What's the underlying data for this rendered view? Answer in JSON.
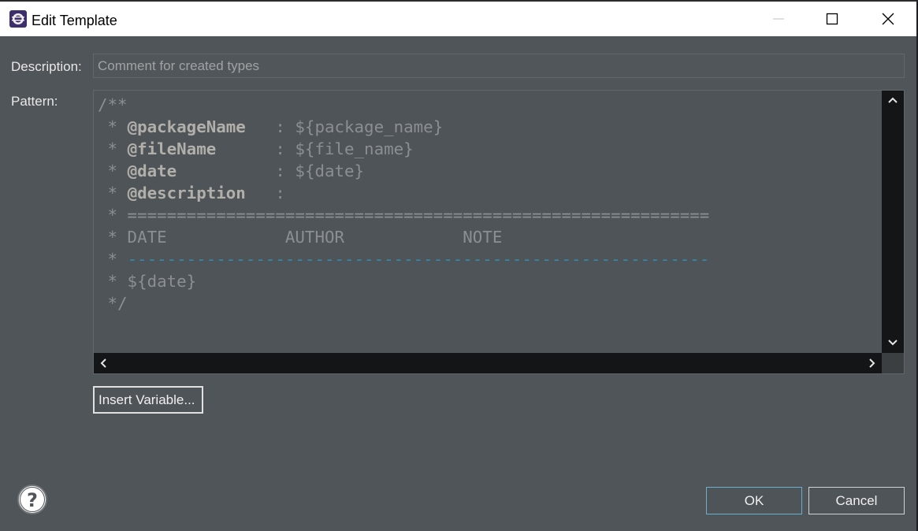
{
  "window": {
    "title": "Edit Template"
  },
  "form": {
    "description_label": "Description:",
    "description_value": "Comment for created types",
    "pattern_label": "Pattern:"
  },
  "pattern": {
    "lines": [
      [
        {
          "t": "/**",
          "c": "plain"
        }
      ],
      [
        {
          "t": " * ",
          "c": "plain"
        },
        {
          "t": "@packageName",
          "c": "tag"
        },
        {
          "t": "   : ${package_name}",
          "c": "plain"
        }
      ],
      [
        {
          "t": " * ",
          "c": "plain"
        },
        {
          "t": "@fileName",
          "c": "tag"
        },
        {
          "t": "      : ${file_name}",
          "c": "plain"
        }
      ],
      [
        {
          "t": " * ",
          "c": "plain"
        },
        {
          "t": "@date",
          "c": "tag"
        },
        {
          "t": "          : ${date}",
          "c": "plain"
        }
      ],
      [
        {
          "t": " * ",
          "c": "plain"
        },
        {
          "t": "@description",
          "c": "tag"
        },
        {
          "t": "   :",
          "c": "plain"
        }
      ],
      [
        {
          "t": " * ===========================================================",
          "c": "plain"
        }
      ],
      [
        {
          "t": " * DATE            AUTHOR            NOTE",
          "c": "plain"
        }
      ],
      [
        {
          "t": " * ",
          "c": "plain"
        },
        {
          "t": "-----------------------------------------------------------",
          "c": "dash"
        }
      ],
      [
        {
          "t": " * ${date}",
          "c": "plain"
        }
      ],
      [
        {
          "t": " */",
          "c": "plain"
        }
      ]
    ]
  },
  "buttons": {
    "insert_variable": "Insert Variable...",
    "ok": "OK",
    "cancel": "Cancel"
  },
  "icons": {
    "app": "eclipse-icon",
    "help": "help-icon",
    "minimize": "minimize-icon",
    "maximize": "maximize-icon",
    "close": "close-icon"
  },
  "colors": {
    "dialog_bg": "#505559",
    "annotation": "#b1afa9",
    "dash_line": "#2f8cb0",
    "ok_border": "#6aaed0"
  }
}
